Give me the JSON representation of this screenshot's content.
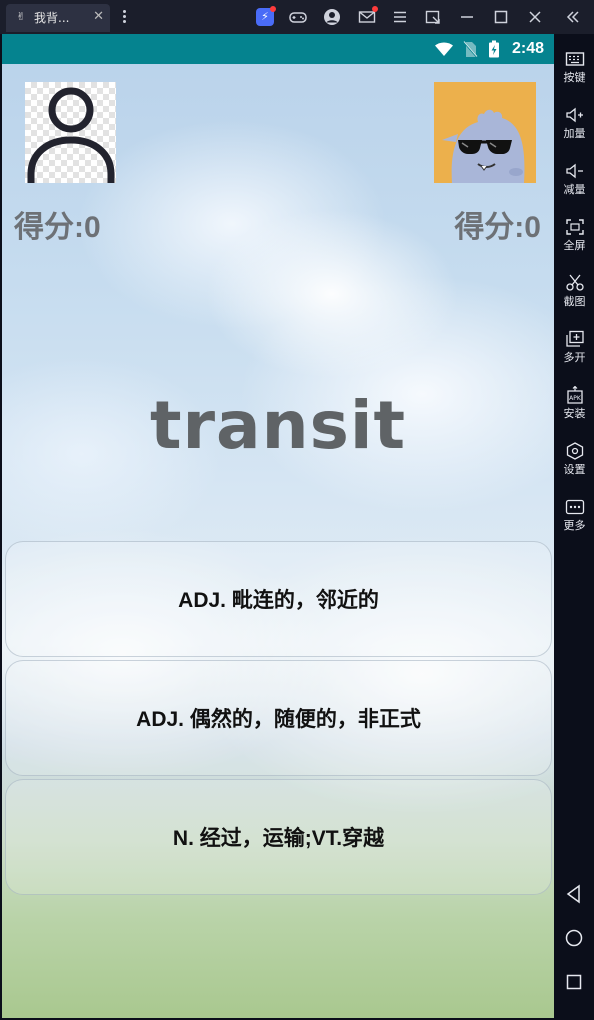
{
  "window": {
    "tab_title": "我背...",
    "tab_close": "✕",
    "app_icon": "bunny-icon"
  },
  "titlebar_icons": [
    "booster-icon",
    "gamepad-icon",
    "account-icon",
    "mail-icon",
    "menu-icon",
    "popout-icon",
    "minimize-icon",
    "maximize-icon",
    "close-icon",
    "collapse-icon"
  ],
  "statusbar": {
    "time": "2:48",
    "icons": [
      "wifi-icon",
      "no-sim-icon",
      "battery-charging-icon"
    ]
  },
  "game": {
    "player1_score": "得分:0",
    "player2_score": "得分:0",
    "word": "transit",
    "options": [
      "ADJ. 毗连的，邻近的",
      "ADJ. 偶然的，随便的，非正式",
      "N. 经过，运输;VT.穿越"
    ]
  },
  "sidebar": {
    "items": [
      {
        "label": "按键",
        "icon": "keyboard-icon"
      },
      {
        "label": "加量",
        "icon": "volume-up-icon"
      },
      {
        "label": "减量",
        "icon": "volume-down-icon"
      },
      {
        "label": "全屏",
        "icon": "fullscreen-icon"
      },
      {
        "label": "截图",
        "icon": "scissors-icon"
      },
      {
        "label": "多开",
        "icon": "multi-instance-icon"
      },
      {
        "label": "安装",
        "icon": "apk-install-icon"
      },
      {
        "label": "设置",
        "icon": "settings-icon"
      },
      {
        "label": "更多",
        "icon": "more-icon"
      }
    ],
    "nav": [
      "back-icon",
      "home-icon",
      "recents-icon"
    ]
  },
  "colors": {
    "statusbar": "#05838f",
    "titlebar": "#1b1e2b",
    "sidebar": "#0b0e1a",
    "avatar_right_bg": "#ecb04c",
    "score_text": "#6d7176"
  }
}
